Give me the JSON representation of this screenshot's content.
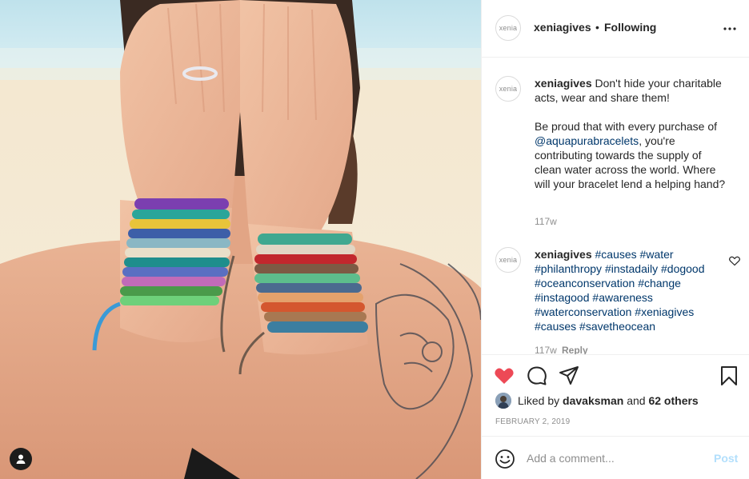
{
  "post": {
    "author": "xeniagives",
    "avatar_text": "xenia",
    "separator": "•",
    "follow_status": "Following",
    "more_icon": "more-horizontal-icon"
  },
  "caption": {
    "user": "xeniagives",
    "line1": "Don't hide your charitable acts, wear and share them!",
    "line2_prefix": "Be proud that with every purchase of ",
    "mention": "@aquapurabracelets",
    "line2_suffix": ", you're contributing towards the supply of clean water across the world. Where will your bracelet lend a helping hand?",
    "time": "117w"
  },
  "comment": {
    "user": "xeniagives",
    "hashtags": [
      "#causes",
      "#water",
      "#philanthropy",
      "#instadaily",
      "#dogood",
      "#oceanconservation",
      "#change",
      "#instagood",
      "#awareness",
      "#waterconservation",
      "#xeniagives",
      "#causes",
      "#savetheocean"
    ],
    "time": "117w",
    "reply": "Reply"
  },
  "actions": {
    "like_icon": "heart-filled-icon",
    "comment_icon": "comment-icon",
    "share_icon": "share-icon",
    "save_icon": "bookmark-icon",
    "like_color": "#ed4956"
  },
  "likes": {
    "prefix": "Liked by ",
    "user": "davaksman",
    "middle": " and ",
    "others": "62 others"
  },
  "date": "FEBRUARY 2, 2019",
  "add_comment": {
    "placeholder": "Add a comment...",
    "post_label": "Post",
    "emoji_icon": "emoji-icon"
  },
  "colors": {
    "link": "#00376b",
    "muted": "#8e8e8e",
    "post_disabled": "#b2dffc",
    "border": "#efefef"
  }
}
